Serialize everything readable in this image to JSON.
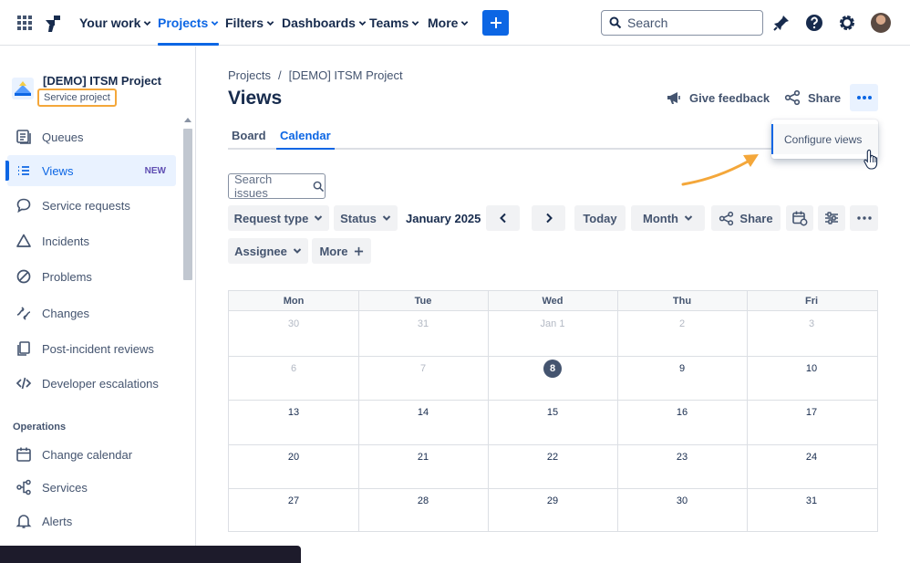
{
  "topnav": {
    "items": [
      {
        "label": "Your work"
      },
      {
        "label": "Projects"
      },
      {
        "label": "Filters"
      },
      {
        "label": "Dashboards"
      },
      {
        "label": "Teams"
      },
      {
        "label": "More"
      }
    ],
    "search_placeholder": "Search",
    "colors": {
      "brand": "#0c66e4",
      "text": "#172b4d"
    }
  },
  "sidebar": {
    "project_name": "[DEMO] ITSM Project",
    "project_type": "Service project",
    "items": [
      {
        "label": "Queues",
        "icon": "queues-icon"
      },
      {
        "label": "Views",
        "icon": "list-icon",
        "badge": "NEW"
      },
      {
        "label": "Service requests",
        "icon": "chat-icon"
      },
      {
        "label": "Incidents",
        "icon": "warning-triangle-icon"
      },
      {
        "label": "Problems",
        "icon": "blocked-icon"
      },
      {
        "label": "Changes",
        "icon": "changes-icon"
      },
      {
        "label": "Post-incident reviews",
        "icon": "pages-icon"
      },
      {
        "label": "Developer escalations",
        "icon": "code-icon"
      }
    ],
    "section_label": "Operations",
    "ops_items": [
      {
        "label": "Change calendar",
        "icon": "calendar-icon"
      },
      {
        "label": "Services",
        "icon": "services-icon"
      },
      {
        "label": "Alerts",
        "icon": "bell-icon"
      }
    ]
  },
  "main": {
    "breadcrumbs": [
      "Projects",
      "/",
      "[DEMO] ITSM Project"
    ],
    "title": "Views",
    "give_feedback": "Give feedback",
    "share": "Share",
    "tabs": [
      {
        "label": "Board"
      },
      {
        "label": "Calendar"
      }
    ],
    "dropdown_item": "Configure views",
    "search_placeholder": "Search issues",
    "filters": {
      "request_type": "Request type",
      "status": "Status",
      "month_label": "January 2025",
      "today": "Today",
      "month": "Month",
      "share": "Share",
      "assignee": "Assignee",
      "more": "More"
    }
  },
  "calendar": {
    "day_names": [
      "Mon",
      "Tue",
      "Wed",
      "Thu",
      "Fri"
    ],
    "weeks": [
      [
        "30",
        "31",
        "Jan 1",
        "2",
        "3"
      ],
      [
        "6",
        "7",
        "8",
        "9",
        "10"
      ],
      [
        "13",
        "14",
        "15",
        "16",
        "17"
      ],
      [
        "20",
        "21",
        "22",
        "23",
        "24"
      ],
      [
        "27",
        "28",
        "29",
        "30",
        "31"
      ]
    ],
    "muted": [
      [
        0,
        0
      ],
      [
        0,
        1
      ],
      [
        0,
        2
      ],
      [
        0,
        3
      ],
      [
        0,
        4
      ],
      [
        1,
        0
      ],
      [
        1,
        1
      ]
    ],
    "today": [
      1,
      2
    ]
  }
}
